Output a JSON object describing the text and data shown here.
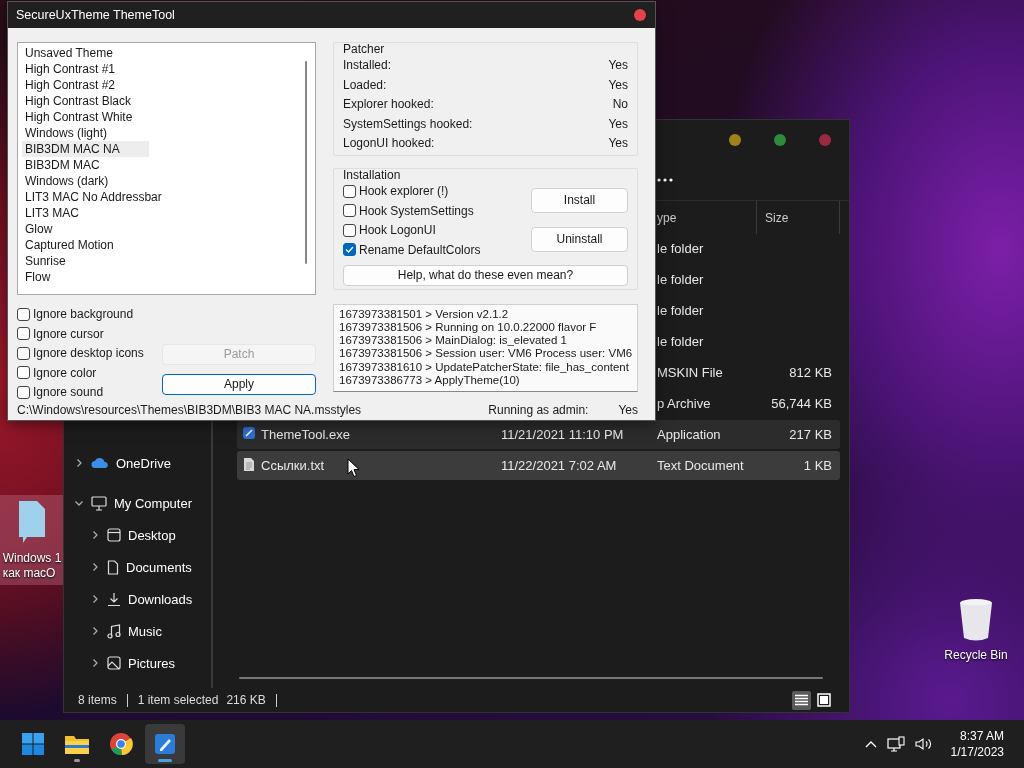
{
  "desktop_icons": [
    {
      "kind": "document",
      "lines": [
        "Windows 1",
        "как macO"
      ],
      "selected": true
    },
    {
      "kind": "recycle-bin",
      "lines": [
        "Recycle Bin"
      ],
      "selected": false
    }
  ],
  "explorer": {
    "columns": [
      "ype",
      "Size"
    ],
    "rows": [
      {
        "type": "le folder",
        "selected": false,
        "hovered": false
      },
      {
        "type": "le folder",
        "selected": false,
        "hovered": false
      },
      {
        "type": "le folder",
        "selected": false,
        "hovered": false
      },
      {
        "type": "le folder",
        "selected": false,
        "hovered": false
      },
      {
        "type": "MSKIN File",
        "size": "812 KB",
        "selected": false,
        "hovered": false
      },
      {
        "type": "p Archive",
        "size": "56,744 KB",
        "selected": false,
        "hovered": false
      },
      {
        "kind": "app",
        "name": "ThemeTool.exe",
        "date": "11/21/2021 11:10 PM",
        "type": "Application",
        "size": "217 KB",
        "selected": true,
        "hovered": false
      },
      {
        "kind": "text",
        "name": "Ссылки.txt",
        "date": "11/22/2021 7:02 AM",
        "type": "Text Document",
        "size": "1 KB",
        "selected": false,
        "hovered": true
      }
    ],
    "sidebar": [
      {
        "kind": "cloud",
        "label": "OneDrive",
        "expanded": false
      },
      {
        "kind": "computer",
        "label": "My Computer",
        "expanded": true,
        "children": [
          {
            "kind": "desktop",
            "label": "Desktop",
            "expanded": false
          },
          {
            "kind": "document",
            "label": "Documents",
            "expanded": false
          },
          {
            "kind": "download",
            "label": "Downloads",
            "expanded": false
          },
          {
            "kind": "music",
            "label": "Music",
            "expanded": false
          },
          {
            "kind": "picture",
            "label": "Pictures",
            "expanded": false
          }
        ]
      }
    ],
    "status": {
      "count": "8 items",
      "selection": "1 item selected",
      "size": "216 KB"
    },
    "views": [
      {
        "kind": "details",
        "selected": true
      },
      {
        "kind": "tiles",
        "selected": false
      }
    ]
  },
  "theme_tool": {
    "title": "SecureUxTheme ThemeTool",
    "themes": [
      {
        "label": "Unsaved Theme",
        "selected": false
      },
      {
        "label": "High Contrast #1",
        "selected": false
      },
      {
        "label": "High Contrast #2",
        "selected": false
      },
      {
        "label": "High Contrast Black",
        "selected": false
      },
      {
        "label": "High Contrast White",
        "selected": false
      },
      {
        "label": "Windows (light)",
        "selected": false
      },
      {
        "label": "BIB3DM MAC NA",
        "selected": true
      },
      {
        "label": "BIB3DM MAC",
        "selected": false
      },
      {
        "label": "Windows (dark)",
        "selected": false
      },
      {
        "label": "LIT3 MAC No Addressbar",
        "selected": false
      },
      {
        "label": "LIT3 MAC",
        "selected": false
      },
      {
        "label": "Glow",
        "selected": false
      },
      {
        "label": "Captured Motion",
        "selected": false
      },
      {
        "label": "Sunrise",
        "selected": false
      },
      {
        "label": "Flow",
        "selected": false
      }
    ],
    "options": [
      {
        "label": "Ignore background",
        "checked": false
      },
      {
        "label": "Ignore cursor",
        "checked": false
      },
      {
        "label": "Ignore desktop icons",
        "checked": false
      },
      {
        "label": "Ignore color",
        "checked": false
      },
      {
        "label": "Ignore sound",
        "checked": false
      }
    ],
    "buttons": [
      {
        "label": "Patch",
        "disabled": true,
        "default": false
      },
      {
        "label": "Apply",
        "disabled": false,
        "default": true
      }
    ],
    "path": "C:\\Windows\\resources\\Themes\\BIB3DM\\BIB3 MAC NA.msstyles",
    "patcher": {
      "title": "Patcher",
      "rows": [
        {
          "label": "Installed:",
          "value": "Yes"
        },
        {
          "label": "Loaded:",
          "value": "Yes"
        },
        {
          "label": "Explorer hooked:",
          "value": "No"
        },
        {
          "label": "SystemSettings hooked:",
          "value": "Yes"
        },
        {
          "label": "LogonUI hooked:",
          "value": "Yes"
        }
      ]
    },
    "installation": {
      "title": "Installation",
      "options": [
        {
          "label": "Hook explorer (!)",
          "checked": false
        },
        {
          "label": "Hook SystemSettings",
          "checked": false
        },
        {
          "label": "Hook LogonUI",
          "checked": false
        },
        {
          "label": "Rename DefaultColors",
          "checked": true
        }
      ],
      "buttons": [
        "Install",
        "Uninstall"
      ],
      "help": "Help, what do these even mean?"
    },
    "log": [
      "1673973381501 > Version v2.1.2",
      "1673973381506 > Running on 10.0.22000 flavor F",
      "1673973381506 > MainDialog: is_elevated 1",
      "1673973381506 > Session user: VM6 Process user: VM6",
      "1673973381610 > UpdatePatcherState: file_has_content",
      "1673973386773 > ApplyTheme(10)"
    ],
    "admin": {
      "label": "Running as admin:",
      "value": "Yes"
    }
  },
  "taskbar": {
    "apps": [
      {
        "kind": "start",
        "running": false,
        "active": false
      },
      {
        "kind": "folder",
        "running": true,
        "active": false
      },
      {
        "kind": "browser",
        "running": false,
        "active": false
      },
      {
        "kind": "themetool",
        "running": true,
        "active": true
      }
    ],
    "time": "8:37 AM",
    "date": "1/17/2023"
  }
}
